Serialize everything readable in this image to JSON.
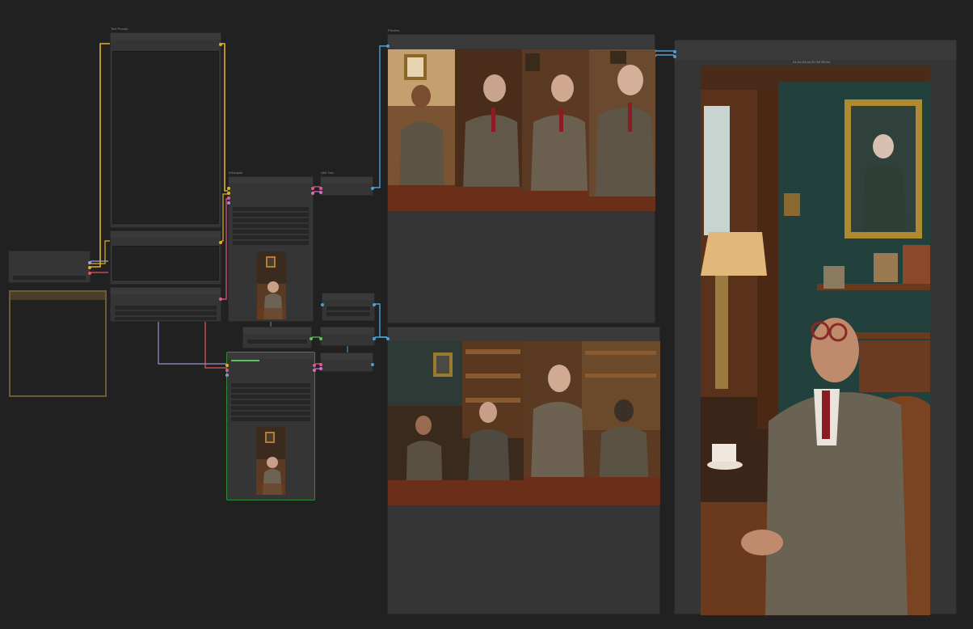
{
  "nodes": {
    "prompt_node": {
      "title": "Text Prompt"
    },
    "loader_node": {
      "title": ""
    },
    "encode_node": {
      "title": ""
    },
    "sampler_a": {
      "title": "KSampler",
      "footer": ""
    },
    "sampler_b": {
      "title": "",
      "footer": ""
    },
    "decode_top": {
      "title": "VAE Dec"
    },
    "preview_top": {
      "title": "Preview"
    },
    "preview_bottom": {
      "title": ""
    },
    "preview_large": {
      "title": ""
    }
  },
  "gallery_tabs": "A1 A2 A3 A4 B1 B2 B3 B4",
  "colors": {
    "canvas": "#212121",
    "node": "#353535",
    "wire_yellow": "#e0b020",
    "wire_blue": "#4a9fd8",
    "wire_pink": "#e05890",
    "wire_purple": "#a08cd8",
    "wire_green": "#5ec05e",
    "group_border": "#6e5a35",
    "selected_border": "#2e8b3a"
  }
}
